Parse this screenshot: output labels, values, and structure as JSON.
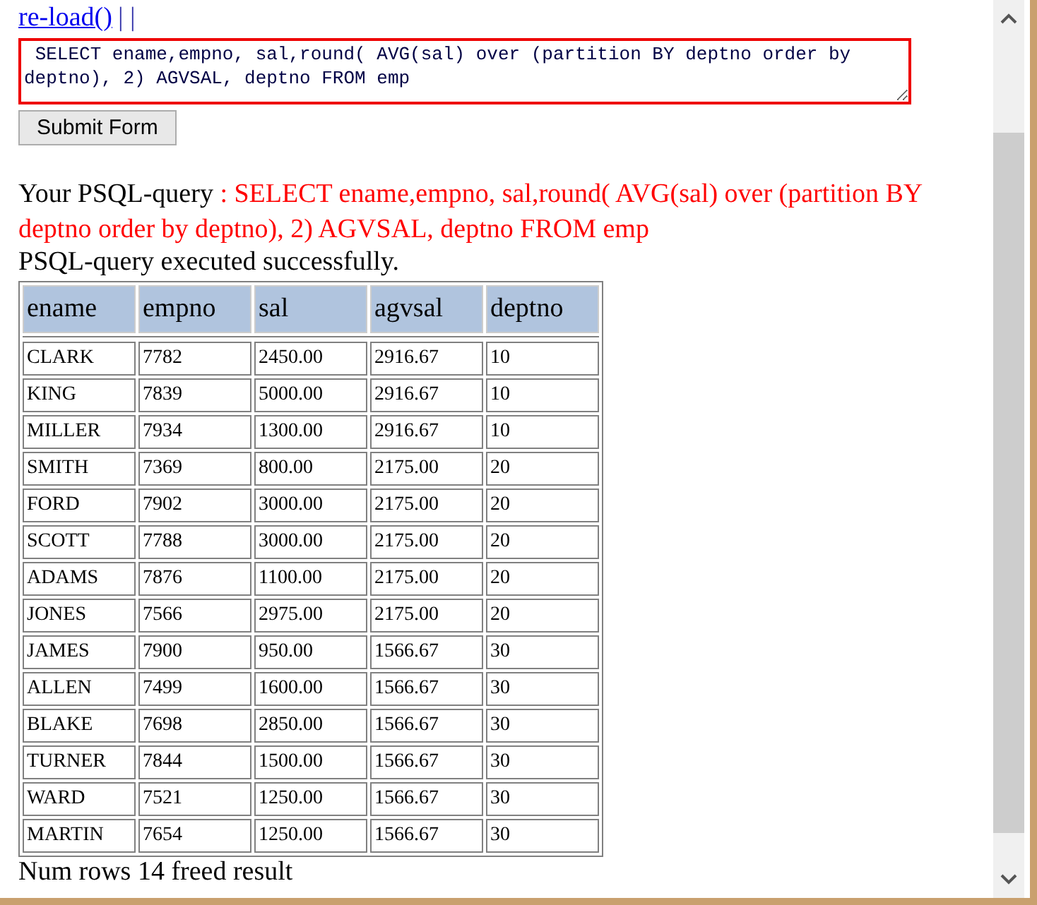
{
  "reload_link": "re-load()",
  "separator": "| |",
  "query_field": {
    "value": " SELECT ename,empno, sal,round( AVG(sal) over (partition BY deptno order by deptno), 2) AGVSAL, deptno FROM emp"
  },
  "submit_button": "Submit Form",
  "query_label": "Your PSQL-query",
  "query_echo": ": SELECT ename,empno, sal,round( AVG(sal) over (partition BY deptno order by deptno), 2) AGVSAL, deptno FROM emp",
  "status": "PSQL-query executed successfully.",
  "table": {
    "columns": [
      "ename",
      "empno",
      "sal",
      "agvsal",
      "deptno"
    ],
    "rows": [
      [
        "CLARK",
        "7782",
        "2450.00",
        "2916.67",
        "10"
      ],
      [
        "KING",
        "7839",
        "5000.00",
        "2916.67",
        "10"
      ],
      [
        "MILLER",
        "7934",
        "1300.00",
        "2916.67",
        "10"
      ],
      [
        "SMITH",
        "7369",
        "800.00",
        "2175.00",
        "20"
      ],
      [
        "FORD",
        "7902",
        "3000.00",
        "2175.00",
        "20"
      ],
      [
        "SCOTT",
        "7788",
        "3000.00",
        "2175.00",
        "20"
      ],
      [
        "ADAMS",
        "7876",
        "1100.00",
        "2175.00",
        "20"
      ],
      [
        "JONES",
        "7566",
        "2975.00",
        "2175.00",
        "20"
      ],
      [
        "JAMES",
        "7900",
        "950.00",
        "1566.67",
        "30"
      ],
      [
        "ALLEN",
        "7499",
        "1600.00",
        "1566.67",
        "30"
      ],
      [
        "BLAKE",
        "7698",
        "2850.00",
        "1566.67",
        "30"
      ],
      [
        "TURNER",
        "7844",
        "1500.00",
        "1566.67",
        "30"
      ],
      [
        "WARD",
        "7521",
        "1250.00",
        "1566.67",
        "30"
      ],
      [
        "MARTIN",
        "7654",
        "1250.00",
        "1566.67",
        "30"
      ]
    ]
  },
  "footer": "Num rows 14 freed result"
}
